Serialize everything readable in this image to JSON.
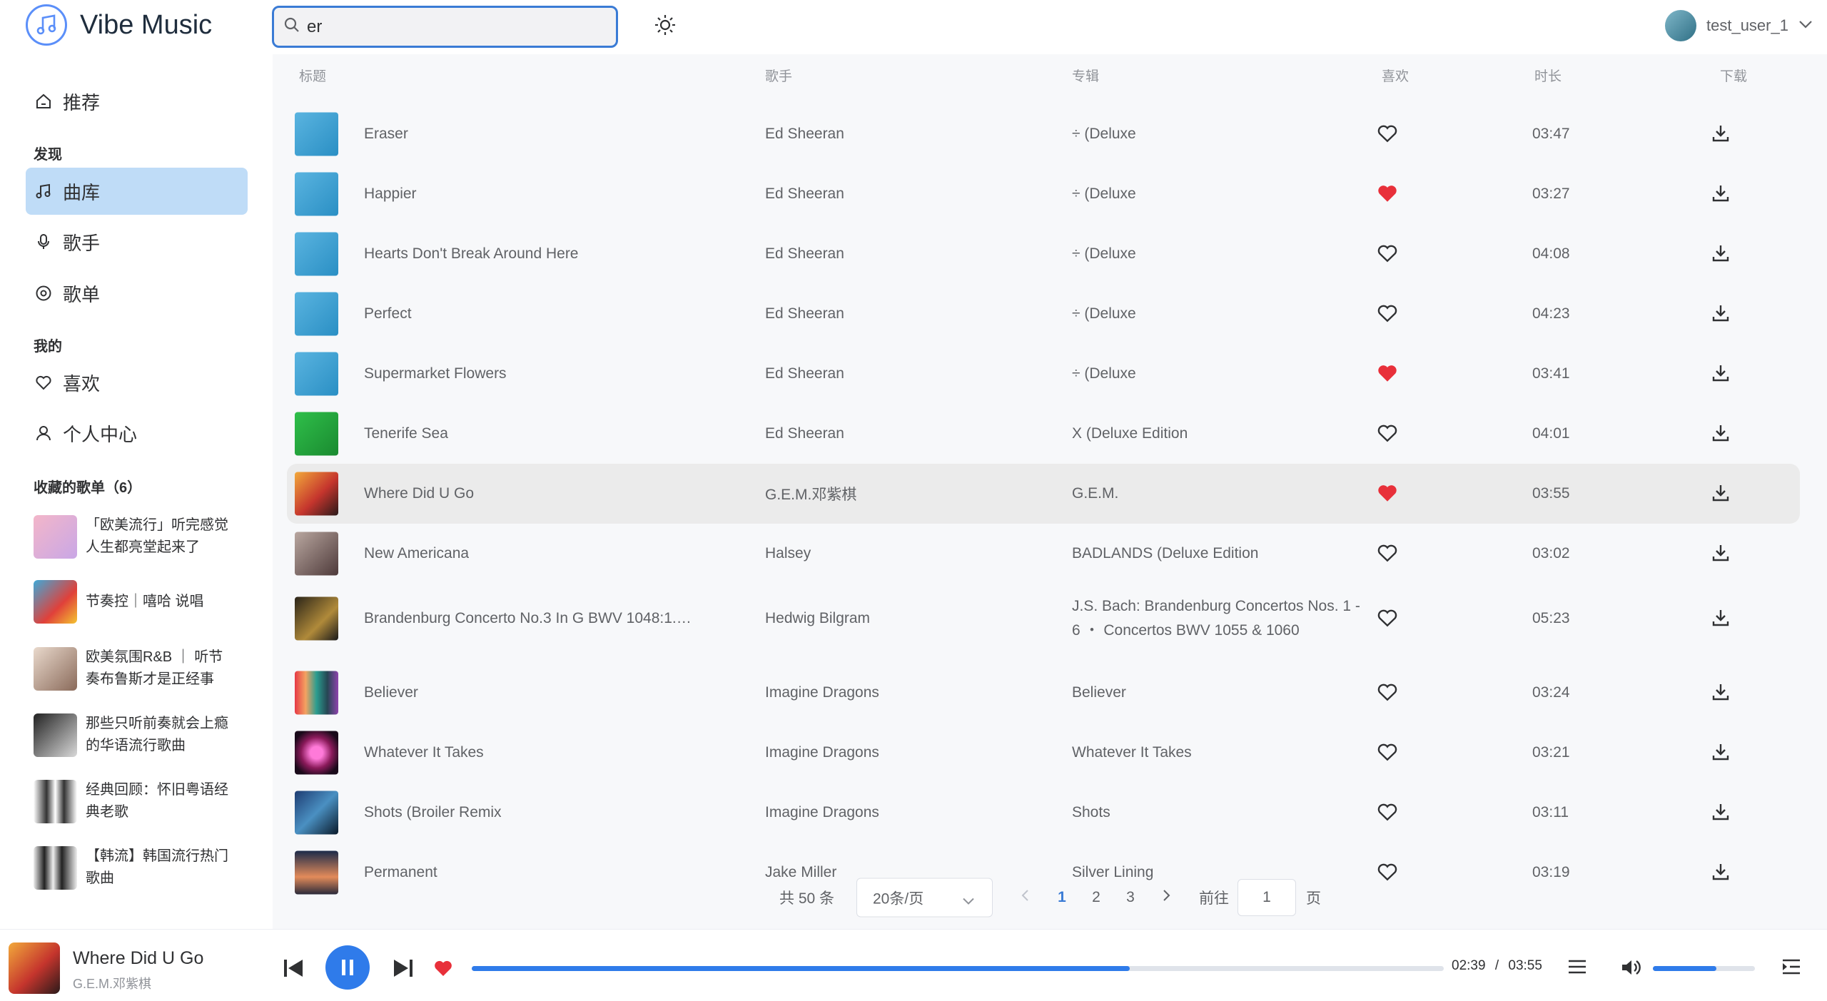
{
  "app": {
    "title": "Vibe Music"
  },
  "search": {
    "value": "er"
  },
  "user": {
    "name": "test_user_1"
  },
  "nav": {
    "recommend": "推荐",
    "discover_label": "发现",
    "library": "曲库",
    "artists": "歌手",
    "playlists": "歌单",
    "mine_label": "我的",
    "favorites": "喜欢",
    "profile": "个人中心",
    "collected_label": "收藏的歌单（6）"
  },
  "collected_playlists": [
    {
      "line1": "「欧美流行」听完感觉",
      "line2": "人生都亮堂起来了"
    },
    {
      "line1": "节奏控｜嘻哈 说唱",
      "line2": ""
    },
    {
      "line1": "欧美氛围R&B ｜ 听节",
      "line2": "奏布鲁斯才是正经事"
    },
    {
      "line1": "那些只听前奏就会上瘾",
      "line2": "的华语流行歌曲"
    },
    {
      "line1": "经典回顾：怀旧粤语经",
      "line2": "典老歌"
    },
    {
      "line1": "【韩流】韩国流行热门",
      "line2": "歌曲"
    }
  ],
  "table": {
    "headers": {
      "title": "标题",
      "artist": "歌手",
      "album": "专辑",
      "like": "喜欢",
      "duration": "时长",
      "download": "下载"
    },
    "rows": [
      {
        "title": "Eraser",
        "artist": "Ed Sheeran",
        "album": "÷ (Deluxe",
        "duration": "03:47",
        "liked": false
      },
      {
        "title": "Happier",
        "artist": "Ed Sheeran",
        "album": "÷ (Deluxe",
        "duration": "03:27",
        "liked": true
      },
      {
        "title": "Hearts Don't Break Around Here",
        "artist": "Ed Sheeran",
        "album": "÷ (Deluxe",
        "duration": "04:08",
        "liked": false
      },
      {
        "title": "Perfect",
        "artist": "Ed Sheeran",
        "album": "÷ (Deluxe",
        "duration": "04:23",
        "liked": false
      },
      {
        "title": "Supermarket Flowers",
        "artist": "Ed Sheeran",
        "album": "÷ (Deluxe",
        "duration": "03:41",
        "liked": true
      },
      {
        "title": "Tenerife Sea",
        "artist": "Ed Sheeran",
        "album": "X (Deluxe Edition",
        "duration": "04:01",
        "liked": false
      },
      {
        "title": "Where Did U Go",
        "artist": "G.E.M.邓紫棋",
        "album": "G.E.M.",
        "duration": "03:55",
        "liked": true
      },
      {
        "title": "New Americana",
        "artist": "Halsey",
        "album": "BADLANDS (Deluxe Edition",
        "duration": "03:02",
        "liked": false
      },
      {
        "title": "Brandenburg Concerto No.3 In G BWV 1048:1.…",
        "artist": "Hedwig Bilgram",
        "album": "J.S. Bach: Brandenburg Concertos Nos. 1 - 6 ・ Concertos BWV 1055 & 1060",
        "duration": "05:23",
        "liked": false
      },
      {
        "title": "Believer",
        "artist": "Imagine Dragons",
        "album": "Believer",
        "duration": "03:24",
        "liked": false
      },
      {
        "title": "Whatever It Takes",
        "artist": "Imagine Dragons",
        "album": "Whatever It Takes",
        "duration": "03:21",
        "liked": false
      },
      {
        "title": "Shots (Broiler Remix",
        "artist": "Imagine Dragons",
        "album": "Shots",
        "duration": "03:11",
        "liked": false
      },
      {
        "title": "Permanent",
        "artist": "Jake Miller",
        "album": "Silver Lining",
        "duration": "03:19",
        "liked": false
      }
    ]
  },
  "pagination": {
    "total": "共 50 条",
    "page_size": "20条/页",
    "pages": [
      "1",
      "2",
      "3"
    ],
    "current": "1",
    "goto_label": "前往",
    "goto_value": "1",
    "page_suffix": "页"
  },
  "player": {
    "title": "Where Did U Go",
    "artist": "G.E.M.邓紫棋",
    "current_time": "02:39",
    "separator": "/",
    "total_time": "03:55",
    "progress": 0.677,
    "volume": 0.62,
    "liked": true
  },
  "colors": {
    "accent": "#2f7bea",
    "like": "#e8303a",
    "active_nav": "#bfdcf7"
  }
}
